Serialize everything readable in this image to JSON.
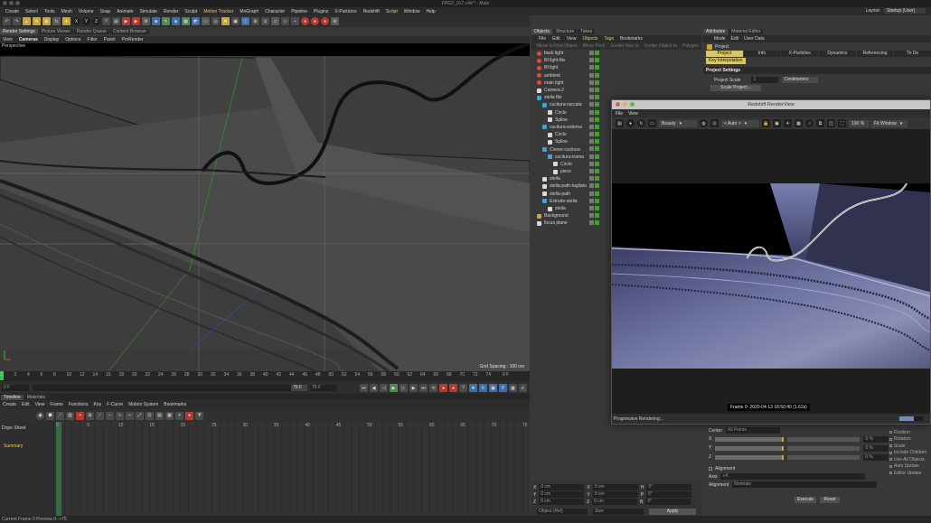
{
  "window": {
    "title": "FRG2_017.c4d * - Main"
  },
  "menubar": {
    "items": [
      "Create",
      "Select",
      "Tools",
      "Mesh",
      "Volume",
      "Snap",
      "Animate",
      "Simulate",
      "Render",
      "Sculpt",
      "Motion Tracker",
      "MoGraph",
      "Character",
      "Pipeline",
      "Plugins",
      "X-Particles",
      "Redshift",
      "Script",
      "Window",
      "Help"
    ],
    "layout_label": "Layout:",
    "layout_value": "Startup (User)"
  },
  "left_tabs": [
    "Render Settings",
    "Picture Viewer",
    "Render Queue",
    "Content Browser"
  ],
  "viewport": {
    "menu": [
      "View",
      "Cameras",
      "Display",
      "Options",
      "Filter",
      "Panel",
      "ProRender"
    ],
    "label": "Perspective",
    "grid_spacing": "Grid Spacing : 100 cm"
  },
  "timeline": {
    "ruler": [
      "0",
      "2",
      "4",
      "6",
      "8",
      "10",
      "12",
      "14",
      "16",
      "18",
      "20",
      "22",
      "24",
      "26",
      "28",
      "30",
      "32",
      "34",
      "36",
      "38",
      "40",
      "42",
      "44",
      "46",
      "48",
      "50",
      "52",
      "54",
      "56",
      "58",
      "60",
      "62",
      "64",
      "66",
      "68",
      "70",
      "72",
      "74"
    ],
    "current_frame": "0 F",
    "start_frame": "0 F",
    "end_frame": "75 F",
    "end_frame2": "75 F",
    "frame_field": "0 F",
    "tabs": [
      "Timeline",
      "Materials"
    ],
    "menu": [
      "Create",
      "Edit",
      "View",
      "Frame",
      "Functions",
      "Key",
      "F-Curve",
      "Motion System",
      "Bookmarks"
    ],
    "dope_label": "Dope Sheet",
    "summary": "Summary",
    "dope_ruler": [
      "0",
      "5",
      "10",
      "15",
      "20",
      "25",
      "30",
      "35",
      "40",
      "45",
      "50",
      "55",
      "60",
      "65",
      "70",
      "75"
    ]
  },
  "status": {
    "text": "Current Frame  0  Preview  0-->75"
  },
  "objects": {
    "tabs": [
      "Objects",
      "Structure",
      "Takes"
    ],
    "menu": [
      "File",
      "Edit",
      "View",
      "Objects",
      "Tags",
      "Bookmarks"
    ],
    "bar": [
      "Move to First Object",
      "Move Pivot",
      "Center Axis to",
      "Center Object to",
      "Polygon"
    ],
    "items": [
      {
        "name": "back light",
        "icon": "l",
        "indent": 0
      },
      {
        "name": "fill light-fiio",
        "icon": "l",
        "indent": 0
      },
      {
        "name": "fill light",
        "icon": "l",
        "indent": 0
      },
      {
        "name": "ambient",
        "icon": "l",
        "indent": 0
      },
      {
        "name": "main light",
        "icon": "l",
        "indent": 0
      },
      {
        "name": "Camera.2",
        "icon": "c",
        "indent": 0
      },
      {
        "name": "stella filo",
        "icon": "n",
        "indent": 0
      },
      {
        "name": "cucitura-raccata",
        "icon": "n",
        "indent": 1
      },
      {
        "name": "Circle",
        "icon": "c",
        "indent": 2
      },
      {
        "name": "Spline",
        "icon": "c",
        "indent": 2
      },
      {
        "name": "cucitura-esterna",
        "icon": "n",
        "indent": 1
      },
      {
        "name": "Circle",
        "icon": "c",
        "indent": 2
      },
      {
        "name": "Spline",
        "icon": "c",
        "indent": 2
      },
      {
        "name": "Cloner-cucitura",
        "icon": "n",
        "indent": 1
      },
      {
        "name": "cucitura-trama",
        "icon": "n",
        "indent": 2
      },
      {
        "name": "Circle",
        "icon": "c",
        "indent": 3
      },
      {
        "name": "piece",
        "icon": "c",
        "indent": 3
      },
      {
        "name": "stella",
        "icon": "c",
        "indent": 1
      },
      {
        "name": "stella-path-tagliata",
        "icon": "c",
        "indent": 1
      },
      {
        "name": "stella-path",
        "icon": "c",
        "indent": 1
      },
      {
        "name": "Extrude-stella",
        "icon": "n",
        "indent": 1
      },
      {
        "name": "stella",
        "icon": "c",
        "indent": 2
      },
      {
        "name": "Background",
        "icon": "b",
        "indent": 0
      },
      {
        "name": "focus plane",
        "icon": "c",
        "indent": 0
      }
    ],
    "coords": {
      "rows": [
        [
          "X",
          "0 cm",
          "X",
          "0 cm",
          "H",
          "0°"
        ],
        [
          "Y",
          "0 cm",
          "Y",
          "0 cm",
          "P",
          "0°"
        ],
        [
          "Z",
          "0 cm",
          "Z",
          "0 cm",
          "B",
          "0°"
        ]
      ],
      "mode": "Object (Rel)",
      "size": "Size",
      "apply": "Apply"
    }
  },
  "attributes": {
    "tabs": [
      "Attributes",
      "Material Editor"
    ],
    "menu": [
      "Mode",
      "Edit",
      "User Data"
    ],
    "project": "Project",
    "ptabs": [
      "Project Settings",
      "Info",
      "X-Particles",
      "Dynamics",
      "Referencing",
      "To Do"
    ],
    "key_interp": "Key Interpolation",
    "section": "Project Settings",
    "scale_label": "Project Scale",
    "scale_value": "1",
    "scale_unit": "Centimeters",
    "scale_btn": "Scale Project...",
    "center_label": "Center",
    "center_value": "All Points",
    "axes": [
      {
        "axis": "X",
        "value": "0 %"
      },
      {
        "axis": "Y",
        "value": "0 %"
      },
      {
        "axis": "Z",
        "value": "0 %"
      }
    ],
    "right_opts": [
      "Position",
      "Rotation",
      "Scale",
      "Include Children",
      "Use All Objects",
      "Auto Update",
      "Editor Update"
    ],
    "alignment": "Alignment",
    "axis_label": "Axis",
    "axis_value": "+X",
    "alignment_label": "Alignment",
    "alignment_value": "Normals",
    "execute": "Execute",
    "reset": "Reset"
  },
  "renderview": {
    "title": "Redshift RenderView",
    "menu": [
      "File",
      "View"
    ],
    "aov": "Beauty",
    "camera": "< Auto >",
    "zoom": "100 %",
    "fit": "Fit Window",
    "frame_info": "Frame  0:  2020-04-13  18:50:40  (1.62s)",
    "status": "Progressive Rendering...",
    "progress": 0.62,
    "progress_label": "62%"
  },
  "colors": {
    "accent": "#d9c66a",
    "menu_highlight": "#e3c862",
    "light_icon": "#d94b3a"
  }
}
